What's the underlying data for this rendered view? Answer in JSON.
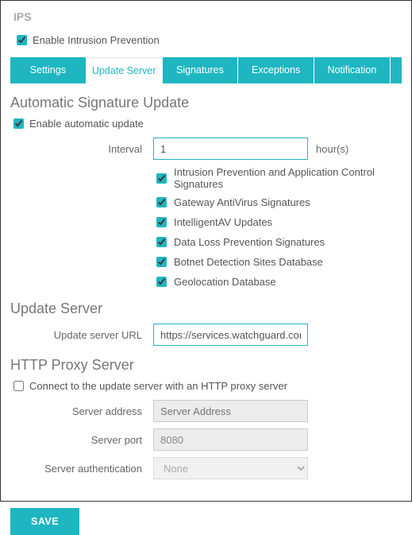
{
  "title": "IPS",
  "enable_ips_label": "Enable Intrusion Prevention",
  "enable_ips_checked": true,
  "tabs": {
    "settings": "Settings",
    "update_server": "Update Server",
    "signatures": "Signatures",
    "exceptions": "Exceptions",
    "notification": "Notification"
  },
  "auto_sig": {
    "heading": "Automatic Signature Update",
    "enable_label": "Enable automatic update",
    "enable_checked": true,
    "interval_label": "Interval",
    "interval_value": "1",
    "interval_unit": "hour(s)",
    "items": [
      {
        "label": "Intrusion Prevention and Application Control Signatures",
        "checked": true
      },
      {
        "label": "Gateway AntiVirus Signatures",
        "checked": true
      },
      {
        "label": "IntelligentAV Updates",
        "checked": true
      },
      {
        "label": "Data Loss Prevention Signatures",
        "checked": true
      },
      {
        "label": "Botnet Detection Sites Database",
        "checked": true
      },
      {
        "label": "Geolocation Database",
        "checked": true
      }
    ]
  },
  "update_server": {
    "heading": "Update Server",
    "url_label": "Update server URL",
    "url_value": "https://services.watchguard.com"
  },
  "proxy": {
    "heading": "HTTP Proxy Server",
    "connect_label": "Connect to the update server with an HTTP proxy server",
    "connect_checked": false,
    "address_label": "Server address",
    "address_placeholder": "Server Address",
    "port_label": "Server port",
    "port_value": "8080",
    "auth_label": "Server authentication",
    "auth_value": "None"
  },
  "save_label": "SAVE"
}
